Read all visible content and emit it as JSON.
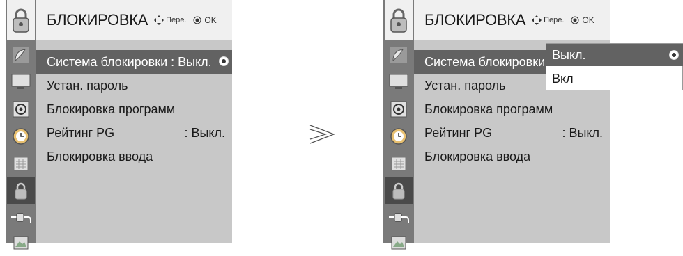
{
  "menu": {
    "title": "БЛОКИРОВКА",
    "hint_move": "Пере.",
    "hint_ok": "OK",
    "items": [
      {
        "label": "Система блокировки : Выкл.",
        "value": ""
      },
      {
        "label": "Устан. пароль",
        "value": ""
      },
      {
        "label": "Блокировка программ",
        "value": ""
      },
      {
        "label": "Рейтинг PG",
        "value": ": Выкл."
      },
      {
        "label": "Блокировка ввода",
        "value": ""
      }
    ]
  },
  "right_menu_items": [
    {
      "label": "Система блокировки",
      "value": ""
    },
    {
      "label": "Устан. пароль",
      "value": ""
    },
    {
      "label": "Блокировка программ",
      "value": ""
    },
    {
      "label": "Рейтинг PG",
      "value": ": Выкл."
    },
    {
      "label": "Блокировка ввода",
      "value": ""
    }
  ],
  "dropdown": {
    "options": [
      "Выкл.",
      "Вкл"
    ]
  },
  "sidebar_icons": [
    "lock-icon",
    "satellite-dish-icon",
    "monitor-icon",
    "speaker-icon",
    "clock-icon",
    "calendar-icon",
    "lock-icon",
    "plug-icon",
    "photo-icon"
  ],
  "colors": {
    "header": "#f0f0f0",
    "menu_bg": "#c8c8c8",
    "sidebar": "#7a7a7a",
    "selected": "#626262"
  }
}
